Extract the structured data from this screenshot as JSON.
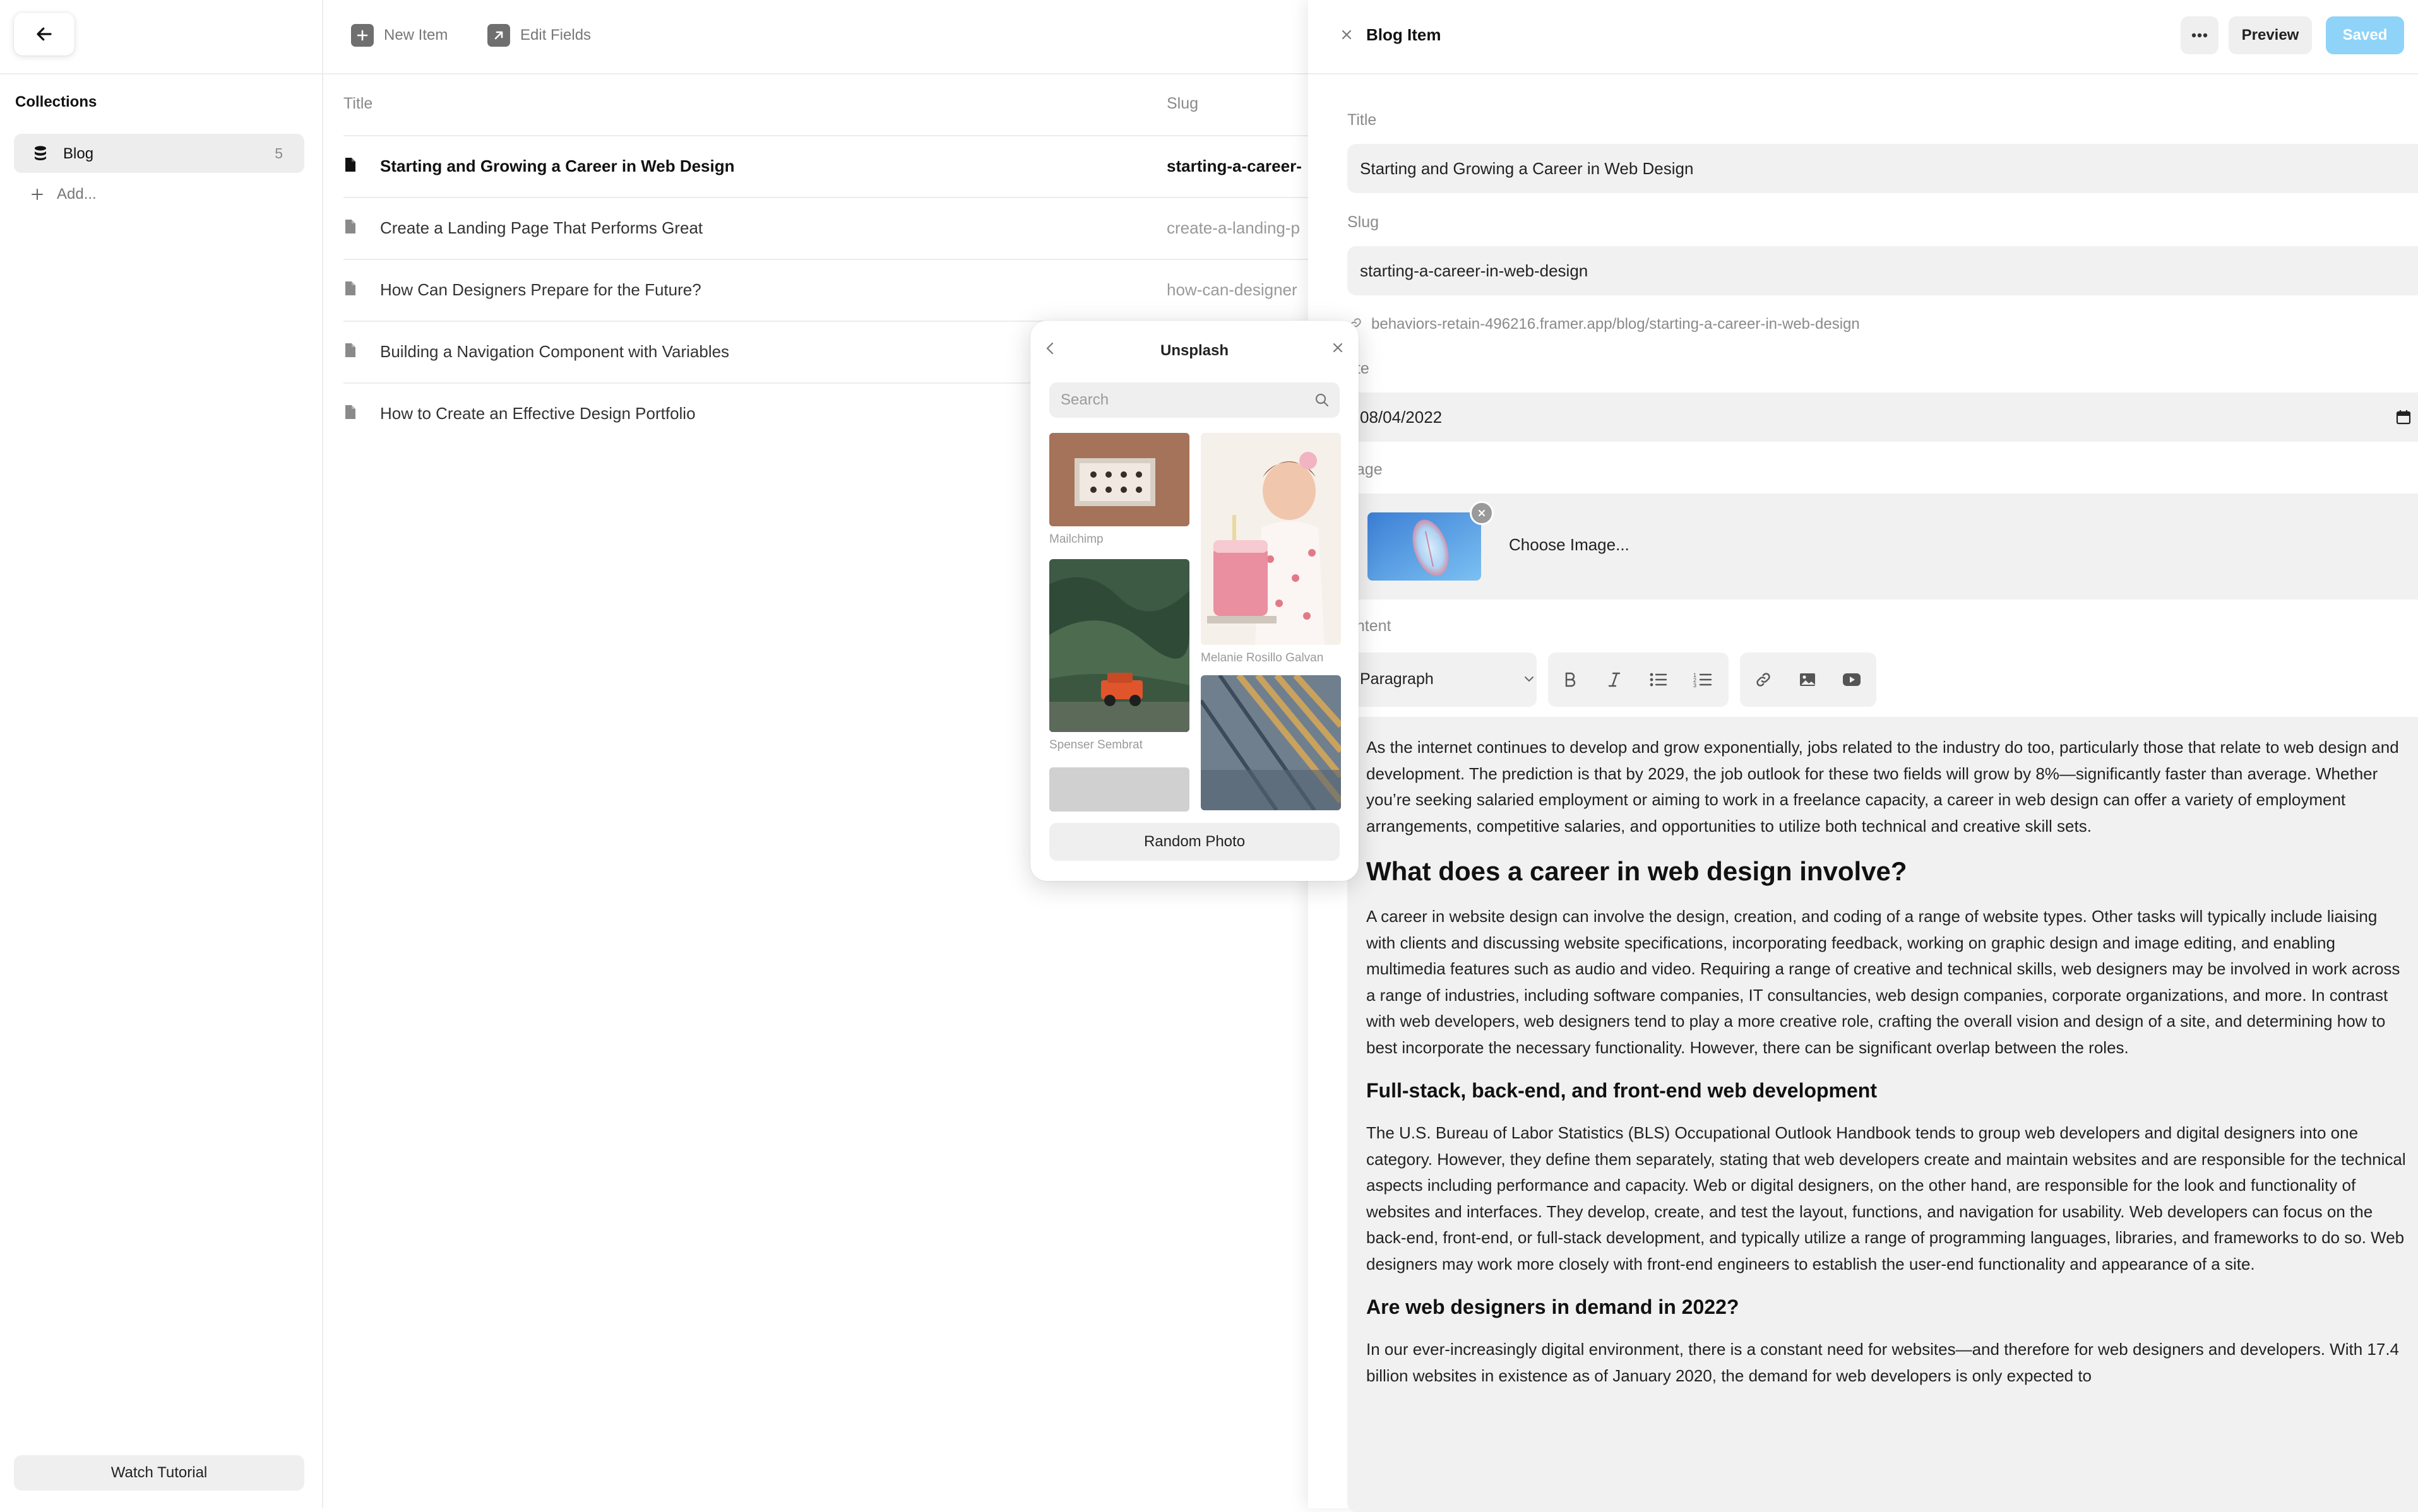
{
  "sidebar": {
    "section_title": "Collections",
    "collections": [
      {
        "label": "Blog",
        "count": "5"
      }
    ],
    "add_label": "Add...",
    "watch_tutorial_label": "Watch Tutorial"
  },
  "toolbar": {
    "new_item_label": "New Item",
    "edit_fields_label": "Edit Fields"
  },
  "list": {
    "columns": {
      "title": "Title",
      "slug": "Slug"
    },
    "rows": [
      {
        "title": "Starting and Growing a Career in Web Design",
        "slug": "starting-a-career-",
        "active": true
      },
      {
        "title": "Create a Landing Page That Performs Great",
        "slug": "create-a-landing-p"
      },
      {
        "title": "How Can Designers Prepare for the Future?",
        "slug": "how-can-designer"
      },
      {
        "title": "Building a Navigation Component with Variables",
        "slug": ""
      },
      {
        "title": "How to Create an Effective Design Portfolio",
        "slug": ""
      }
    ]
  },
  "unsplash": {
    "title": "Unsplash",
    "search_placeholder": "Search",
    "credits": [
      "Mailchimp",
      "Melanie Rosillo Galvan",
      "Spenser Sembrat"
    ],
    "random_label": "Random Photo"
  },
  "editor": {
    "title": "Blog Item",
    "preview_label": "Preview",
    "saved_label": "Saved",
    "saved_color": "#8fd3f8",
    "fields": {
      "title_label": "Title",
      "title_value": "Starting and Growing a Career in Web Design",
      "slug_label": "Slug",
      "slug_value": "starting-a-career-in-web-design",
      "url": "behaviors-retain-496216.framer.app/blog/starting-a-career-in-web-design",
      "date_label": "ate",
      "date_value": "08/04/2022",
      "image_label": "nage",
      "choose_image_label": "Choose Image...",
      "content_label": "ontent",
      "paragraph_style": "Paragraph"
    },
    "content": {
      "p1": "As the internet continues to develop and grow exponentially, jobs related to the industry do too, particularly those that relate to web design and development. The prediction is that by 2029, the job outlook for these two fields will grow by 8%—significantly faster than average. Whether you’re seeking salaried employment or aiming to work in a freelance capacity, a career in web design can offer a variety of employment arrangements, competitive salaries, and opportunities to utilize both technical and creative skill sets.",
      "h2": "What does a career in web design involve?",
      "p2": "A career in website design can involve the design, creation, and coding of a range of website types. Other tasks will typically include liaising with clients and discussing website specifications, incorporating feedback, working on graphic design and image editing, and enabling multimedia features such as audio and video.  Requiring a range of creative and technical skills, web designers may be involved in work across a range of industries, including software companies, IT consultancies, web design companies, corporate organizations, and more. In contrast with web developers, web designers tend to play a more creative role, crafting the overall vision and design of a site, and determining how to best incorporate the necessary functionality. However, there can be significant overlap between the roles.",
      "h3a": "Full-stack, back-end, and front-end web development",
      "p3": "The U.S. Bureau of Labor Statistics (BLS) Occupational Outlook Handbook tends to group web developers and digital designers into one category. However, they define them separately, stating that web developers create and maintain websites and are responsible for the technical aspects including performance and capacity.  Web or digital designers, on the other hand, are responsible for the look and functionality of websites and interfaces. They develop, create, and test the layout, functions, and navigation for usability. Web developers can focus on the back-end, front-end, or full-stack development, and typically utilize a range of programming languages, libraries, and frameworks to do so. Web designers may work more closely with front-end engineers to establish the user-end functionality and appearance of a site.",
      "h3b": "Are web designers in demand in 2022?",
      "p4": "In our ever-increasingly digital environment, there is a constant need for websites—and therefore for web designers and developers. With 17.4 billion websites in existence as of January 2020, the demand for web developers is only expected to"
    }
  }
}
